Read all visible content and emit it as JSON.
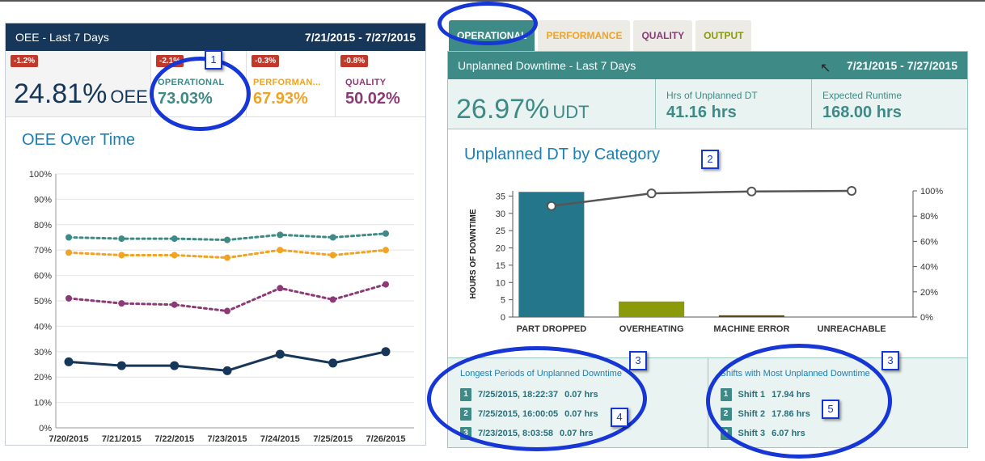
{
  "left": {
    "header_title": "OEE - Last 7 Days",
    "header_range": "7/21/2015 - 7/27/2015",
    "oee": {
      "badge": "-1.2%",
      "value": "24.81%",
      "unit": "OEE"
    },
    "kpis": [
      {
        "badge": "-2.1%",
        "label": "OPERATIONAL",
        "value": "73.03%"
      },
      {
        "badge": "-0.3%",
        "label": "PERFORMAN...",
        "value": "67.93%"
      },
      {
        "badge": "-0.8%",
        "label": "QUALITY",
        "value": "50.02%"
      }
    ],
    "chart_title": "OEE Over Time"
  },
  "tabs": [
    "OPERATIONAL",
    "PERFORMANCE",
    "QUALITY",
    "OUTPUT"
  ],
  "right": {
    "header_title": "Unplanned Downtime - Last 7 Days",
    "header_range": "7/21/2015 - 7/27/2015",
    "udt": {
      "value": "26.97%",
      "unit": "UDT"
    },
    "hrs": {
      "label": "Hrs of Unplanned DT",
      "value": "41.16 hrs"
    },
    "runtime": {
      "label": "Expected Runtime",
      "value": "168.00 hrs"
    },
    "chart_title": "Unplanned DT by Category",
    "longest": {
      "title": "Longest Periods of Unplanned Downtime",
      "items": [
        {
          "n": "1",
          "when": "7/25/2015, 18:22:37",
          "dur": "0.07 hrs"
        },
        {
          "n": "2",
          "when": "7/25/2015, 16:00:05",
          "dur": "0.07 hrs"
        },
        {
          "n": "3",
          "when": "7/23/2015, 8:03:58",
          "dur": "0.07 hrs"
        }
      ]
    },
    "shifts": {
      "title": "Shifts with Most Unplanned Downtime",
      "items": [
        {
          "n": "1",
          "name": "Shift 1",
          "dur": "17.94 hrs"
        },
        {
          "n": "2",
          "name": "Shift 2",
          "dur": "17.86 hrs"
        },
        {
          "n": "3",
          "name": "Shift 3",
          "dur": "6.07 hrs"
        }
      ]
    }
  },
  "callouts": [
    "1",
    "2",
    "3",
    "3",
    "4",
    "5"
  ],
  "colors": {
    "navy": "#16375a",
    "teal": "#3d8a86",
    "orange": "#f0a324",
    "purple": "#8b3a77",
    "olive": "#8a9a0a",
    "red": "#c0392b",
    "annotation": "#1637d6"
  },
  "chart_data": [
    {
      "type": "line",
      "title": "OEE Over Time",
      "x": [
        "7/20/2015",
        "7/21/2015",
        "7/22/2015",
        "7/23/2015",
        "7/24/2015",
        "7/25/2015",
        "7/26/2015"
      ],
      "yticks": [
        "0%",
        "10%",
        "20%",
        "30%",
        "40%",
        "50%",
        "60%",
        "70%",
        "80%",
        "90%",
        "100%"
      ],
      "ylim": [
        0,
        100
      ],
      "series": [
        {
          "values": [
            75,
            74.5,
            74.5,
            74,
            76,
            75,
            76.5
          ],
          "color": "#3d8a86",
          "style": "dotted"
        },
        {
          "values": [
            69,
            68,
            68,
            67,
            70,
            68,
            70
          ],
          "color": "#f0a324",
          "style": "dotted"
        },
        {
          "values": [
            51,
            49,
            48.5,
            46,
            55,
            50.5,
            56.5
          ],
          "color": "#8b3a77",
          "style": "dotted"
        },
        {
          "values": [
            26,
            24.5,
            24.5,
            22.5,
            29,
            25.5,
            30
          ],
          "color": "#16375a",
          "style": "solid"
        }
      ],
      "grid": true
    },
    {
      "type": "bar",
      "title": "Unplanned DT by Category",
      "categories": [
        "PART DROPPED",
        "OVERHEATING",
        "MACHINE ERROR",
        "UNREACHABLE"
      ],
      "values": [
        36.2,
        4.5,
        0.5,
        0
      ],
      "colors": [
        "#24768a",
        "#8a9a0a",
        "#5a4a14",
        "#888888"
      ],
      "ylabel": "HOURS OF DOWNTIME",
      "ylim": [
        0,
        37
      ],
      "yticks": [
        "0",
        "5",
        "10",
        "15",
        "20",
        "25",
        "30",
        "35"
      ],
      "y2ticks": [
        "0%",
        "20%",
        "40%",
        "60%",
        "80%",
        "100%"
      ],
      "cumulative_pct": [
        88,
        98,
        99.5,
        100
      ],
      "line_color": "#555555"
    }
  ]
}
